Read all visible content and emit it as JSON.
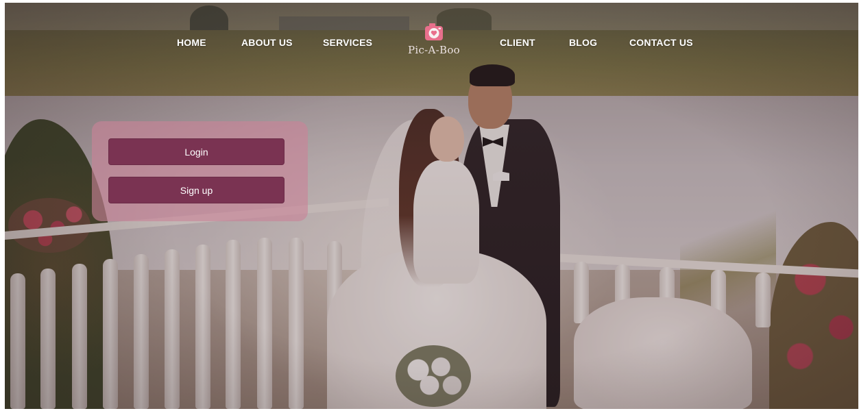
{
  "nav": {
    "items": [
      {
        "label": "HOME"
      },
      {
        "label": "ABOUT US"
      },
      {
        "label": "SERVICES"
      },
      {
        "label": "CLIENT"
      },
      {
        "label": "BLOG"
      },
      {
        "label": "CONTACT US"
      }
    ]
  },
  "brand": {
    "name": "Pic-A-Boo",
    "icon": "camera-heart-icon",
    "icon_color": "#e8708c"
  },
  "auth": {
    "login_label": "Login",
    "signup_label": "Sign up",
    "button_color": "#7a3352",
    "panel_color": "#ca8298"
  }
}
